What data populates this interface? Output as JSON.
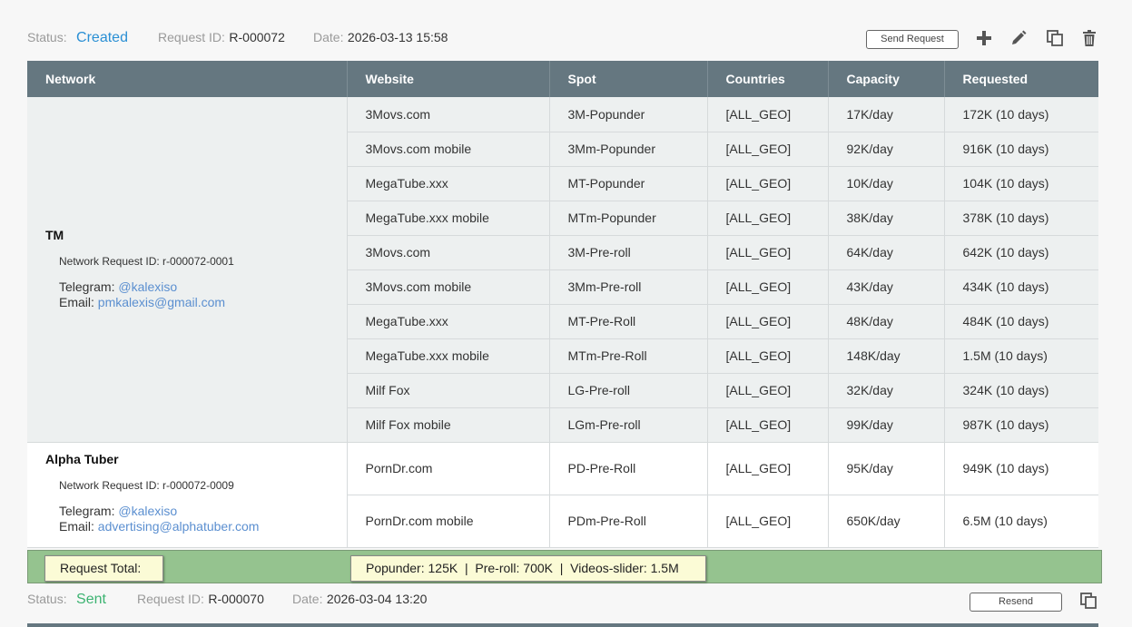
{
  "request1": {
    "status_label": "Status:",
    "status_value": "Created",
    "request_id_label": "Request ID:",
    "request_id": "R-000072",
    "date_label": "Date:",
    "date": "2026-03-13 15:58",
    "send_button": "Send Request"
  },
  "table": {
    "columns": [
      "Network",
      "Website",
      "Spot",
      "Countries",
      "Capacity",
      "Requested"
    ],
    "networks": [
      {
        "name": "TM",
        "network_request_id": "Network Request ID: r-000072-0001",
        "telegram_label": "Telegram:",
        "telegram": "@kalexiso",
        "email_label": "Email:",
        "email": "pmkalexis@gmail.com",
        "rows": [
          {
            "website": "3Movs.com",
            "spot": "3M-Popunder",
            "countries": "[ALL_GEO]",
            "capacity": "17K/day",
            "requested": "172K (10 days)"
          },
          {
            "website": "3Movs.com mobile",
            "spot": "3Mm-Popunder",
            "countries": "[ALL_GEO]",
            "capacity": "92K/day",
            "requested": "916K (10 days)"
          },
          {
            "website": "MegaTube.xxx",
            "spot": "MT-Popunder",
            "countries": "[ALL_GEO]",
            "capacity": "10K/day",
            "requested": "104K (10 days)"
          },
          {
            "website": "MegaTube.xxx mobile",
            "spot": "MTm-Popunder",
            "countries": "[ALL_GEO]",
            "capacity": "38K/day",
            "requested": "378K (10 days)"
          },
          {
            "website": "3Movs.com",
            "spot": "3M-Pre-roll",
            "countries": "[ALL_GEO]",
            "capacity": "64K/day",
            "requested": "642K (10 days)"
          },
          {
            "website": "3Movs.com mobile",
            "spot": "3Mm-Pre-roll",
            "countries": "[ALL_GEO]",
            "capacity": "43K/day",
            "requested": "434K (10 days)"
          },
          {
            "website": "MegaTube.xxx",
            "spot": "MT-Pre-Roll",
            "countries": "[ALL_GEO]",
            "capacity": "48K/day",
            "requested": "484K (10 days)"
          },
          {
            "website": "MegaTube.xxx mobile",
            "spot": "MTm-Pre-Roll",
            "countries": "[ALL_GEO]",
            "capacity": "148K/day",
            "requested": "1.5M (10 days)"
          },
          {
            "website": "Milf Fox",
            "spot": "LG-Pre-roll",
            "countries": "[ALL_GEO]",
            "capacity": "32K/day",
            "requested": "324K (10 days)"
          },
          {
            "website": "Milf Fox mobile",
            "spot": "LGm-Pre-roll",
            "countries": "[ALL_GEO]",
            "capacity": "99K/day",
            "requested": "987K (10 days)"
          }
        ]
      },
      {
        "name": "Alpha Tuber",
        "network_request_id": "Network Request ID: r-000072-0009",
        "telegram_label": "Telegram:",
        "telegram": "@kalexiso",
        "email_label": "Email:",
        "email": "advertising@alphatuber.com",
        "rows": [
          {
            "website": "PornDr.com",
            "spot": "PD-Pre-Roll",
            "countries": "[ALL_GEO]",
            "capacity": "95K/day",
            "requested": "949K (10 days)"
          },
          {
            "website": "PornDr.com mobile",
            "spot": "PDm-Pre-Roll",
            "countries": "[ALL_GEO]",
            "capacity": "650K/day",
            "requested": "6.5M (10 days)"
          }
        ]
      }
    ]
  },
  "totals": {
    "label": "Request Total:",
    "summary": "Popunder: 125K  |  Pre-roll: 700K  |  Videos-slider: 1.5M"
  },
  "request2": {
    "status_label": "Status:",
    "status_value": "Sent",
    "request_id_label": "Request ID:",
    "request_id": "R-000070",
    "date_label": "Date:",
    "date": "2026-03-04 13:20",
    "resend_button": "Resend"
  },
  "icons": {
    "add": "plus-icon",
    "edit": "pencil-icon",
    "copy": "copy-icon",
    "delete": "trash-icon"
  },
  "colors": {
    "status_created": "#2a8fd4",
    "status_sent": "#3cb371",
    "header_bg": "#657780",
    "link": "#5b8fd0",
    "totals_bg": "#95c38f"
  }
}
